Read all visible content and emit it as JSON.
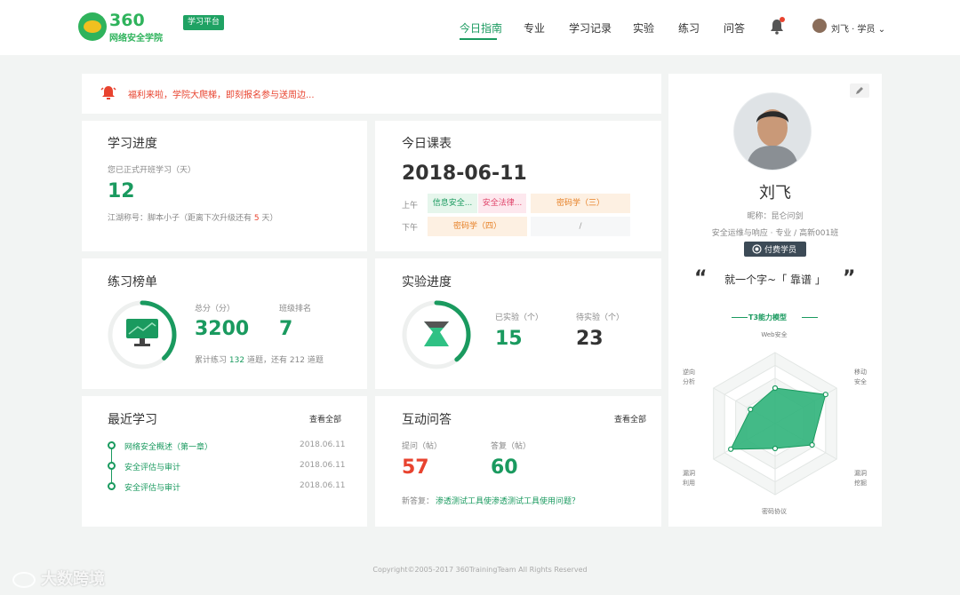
{
  "header": {
    "logo_number": "360",
    "logo_text": "网络安全学院",
    "platform_tag": "学习平台",
    "nav": [
      "今日指南",
      "专业",
      "学习记录",
      "实验",
      "练习",
      "问答"
    ],
    "user_label": "刘飞 · 学员 ⌄"
  },
  "notice": {
    "text": "福利来啦，学院大爬梯，即刻报名参与送周边..."
  },
  "progress": {
    "title": "学习进度",
    "days_label": "您已正式开班学习（天）",
    "days_value": "12",
    "rank_prefix": "江湖称号：脚本小子（距离下次升级还有",
    "rank_days": "5",
    "rank_suffix": "天）"
  },
  "schedule": {
    "title": "今日课表",
    "date": "2018-06-11",
    "am_label": "上午",
    "pm_label": "下午",
    "am_items": [
      "信息安全...",
      "安全法律...",
      "密码学（三）"
    ],
    "pm_items": [
      "密码学（四）",
      "/"
    ]
  },
  "ranking": {
    "title": "练习榜单",
    "score_label": "总分（分）",
    "score_value": "3200",
    "class_rank_label": "班级排名",
    "class_rank_value": "7",
    "summary_prefix": "累计练习",
    "practiced": "132",
    "summary_mid": "道题，还有",
    "remaining": "212",
    "summary_suffix": "道题",
    "progress_fraction": 0.38
  },
  "lab": {
    "title": "实验进度",
    "done_label": "已实验（个）",
    "done_value": "15",
    "todo_label": "待实验（个）",
    "todo_value": "23",
    "progress_fraction": 0.39
  },
  "recent": {
    "title": "最近学习",
    "view_all": "查看全部",
    "items": [
      {
        "name": "网络安全概述（第一章）",
        "date": "2018.06.11"
      },
      {
        "name": "安全评估与审计",
        "date": "2018.06.11"
      },
      {
        "name": "安全评估与审计",
        "date": "2018.06.11"
      }
    ]
  },
  "qa": {
    "title": "互动问答",
    "view_all": "查看全部",
    "ask_label": "提问（帖）",
    "ask_value": "57",
    "answer_label": "答复（帖）",
    "answer_value": "60",
    "latest_prefix": "新答复：",
    "latest_link": "渗透测试工具使渗透测试工具使用问题？"
  },
  "profile": {
    "name": "刘飞",
    "nickname": "昵称：昆仑问剑",
    "program": "安全运维与响应 · 专业 / 高新001班",
    "badge": "付费学员",
    "motto_open": "“",
    "motto": "就一个字~「 靠谱 」",
    "motto_close": "”"
  },
  "radar": {
    "title": "T3能力模型",
    "axes": [
      "Web安全",
      "移动安全",
      "漏洞挖掘",
      "密码协议",
      "漏洞利用",
      "逆向分析"
    ],
    "values": [
      0.5,
      0.82,
      0.6,
      0.35,
      0.72,
      0.4
    ],
    "fill_color": "#2fb37a"
  },
  "footer": {
    "copyright": "Copyright©2005-2017  360TrainingTeam All Rights Reserved"
  },
  "watermark": {
    "text": "大数跨境"
  },
  "colors": {
    "accent": "#1a9a5f",
    "alert": "#e8432f"
  }
}
